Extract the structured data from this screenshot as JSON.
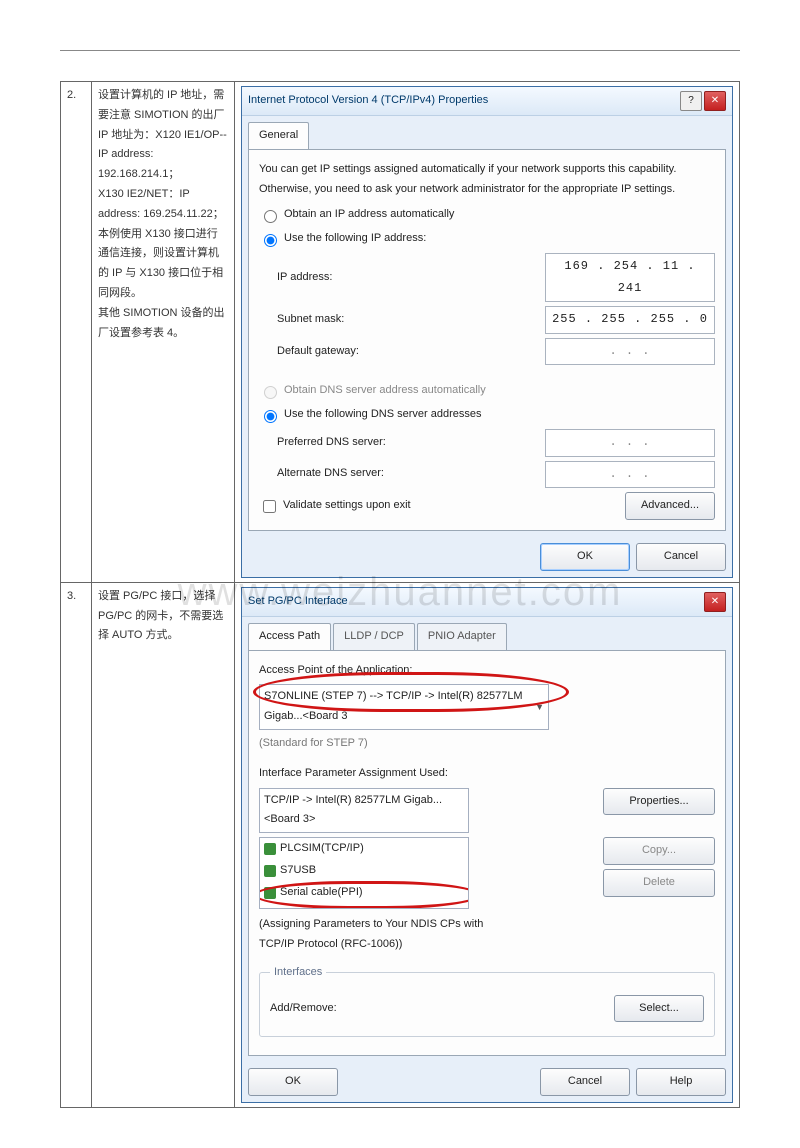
{
  "watermark": "www.weizhuannet.com",
  "rows": {
    "r2": {
      "num": "2.",
      "desc": "设置计算机的 IP 地址，需要注意 SIMOTION 的出厂 IP 地址为：X120 IE1/OP-- IP address: 192.168.214.1；\nX130 IE2/NET：IP address: 169.254.11.22；\n本例使用 X130 接口进行通信连接，则设置计算机的 IP 与 X130 接口位于相同网段。\n其他 SIMOTION 设备的出厂设置参考表 4。"
    },
    "r3": {
      "num": "3.",
      "desc": "设置 PG/PC 接口，选择 PG/PC 的网卡，不需要选择 AUTO 方式。"
    }
  },
  "ipv4": {
    "title": "Internet Protocol Version 4 (TCP/IPv4) Properties",
    "tab_general": "General",
    "intro": "You can get IP settings assigned automatically if your network supports this capability. Otherwise, you need to ask your network administrator for the appropriate IP settings.",
    "opt_auto_ip": "Obtain an IP address automatically",
    "opt_use_ip": "Use the following IP address:",
    "lbl_ip": "IP address:",
    "val_ip": "169 . 254 . 11 . 241",
    "lbl_mask": "Subnet mask:",
    "val_mask": "255 . 255 . 255 .  0",
    "lbl_gw": "Default gateway:",
    "val_gw": " .       .       . ",
    "opt_auto_dns": "Obtain DNS server address automatically",
    "opt_use_dns": "Use the following DNS server addresses",
    "lbl_pdns": "Preferred DNS server:",
    "lbl_adns": "Alternate DNS server:",
    "val_dns_empty": " .       .       . ",
    "chk_validate": "Validate settings upon exit",
    "btn_adv": "Advanced...",
    "btn_ok": "OK",
    "btn_cancel": "Cancel",
    "help_icon": "?"
  },
  "pgpc": {
    "title": "Set PG/PC Interface",
    "tab1": "Access Path",
    "tab2": "LLDP / DCP",
    "tab3": "PNIO Adapter",
    "lbl_ap": "Access Point of the Application:",
    "dropdown": "S7ONLINE     (STEP 7)     --> TCP/IP -> Intel(R) 82577LM Gigab...<Board 3",
    "standard": "(Standard for STEP 7)",
    "lbl_param": "Interface Parameter Assignment Used:",
    "param_field": "TCP/IP -> Intel(R) 82577LM Gigab...<Board 3>",
    "list": {
      "i1": "PLCSIM(TCP/IP)",
      "i2": "S7USB",
      "i3": "Serial cable(PPI)",
      "i4": "TCP/IP -> Intel(R) 82577LM Gigab...<Bo"
    },
    "assign_note1": "(Assigning Parameters to Your NDIS CPs with",
    "assign_note2": "TCP/IP Protocol (RFC-1006))",
    "grp_if": "Interfaces",
    "lbl_add": "Add/Remove:",
    "btn_props": "Properties...",
    "btn_copy": "Copy...",
    "btn_delete": "Delete",
    "btn_select": "Select...",
    "btn_ok": "OK",
    "btn_cancel": "Cancel",
    "btn_help": "Help"
  }
}
